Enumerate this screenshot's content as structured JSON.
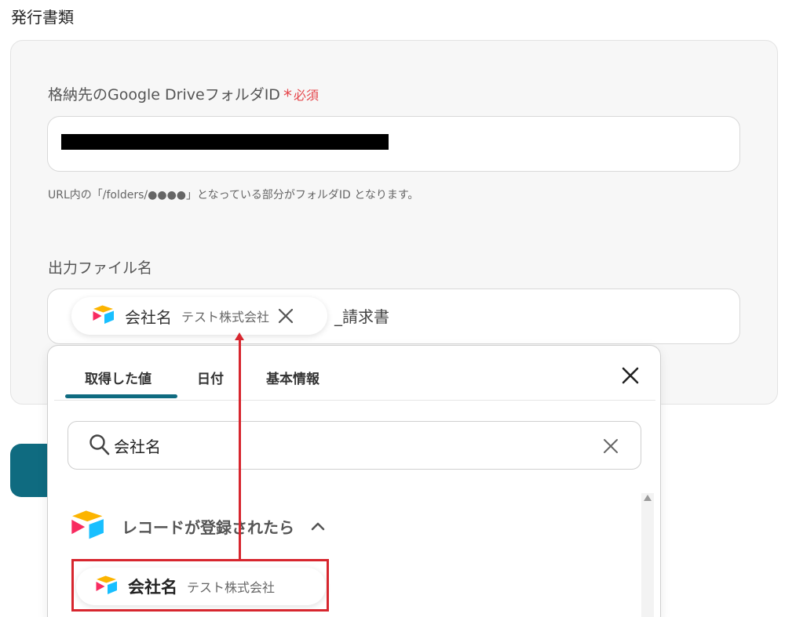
{
  "section": {
    "title": "発行書類"
  },
  "folder_field": {
    "label": "格納先のGoogle DriveフォルダID",
    "required_mark": "*",
    "required_label": "必須",
    "hint": "URL内の「/folders/●●●●」となっている部分がフォルダID となります。"
  },
  "filename_field": {
    "label": "出力ファイル名",
    "chip": {
      "name": "会社名",
      "value": "テスト株式会社"
    },
    "suffix": "_請求書"
  },
  "dropdown": {
    "tabs": [
      {
        "label": "取得した値"
      },
      {
        "label": "日付"
      },
      {
        "label": "基本情報"
      }
    ],
    "active_tab": "取得した値",
    "search": {
      "value": "会社名"
    },
    "group": {
      "title": "レコードが登録されたら"
    },
    "result": {
      "name": "会社名",
      "value": "テスト株式会社"
    }
  },
  "colors": {
    "accent": "#0f6b80",
    "required": "#e5484d",
    "highlight": "#d7262e",
    "airtable_yellow": "#fcb400",
    "airtable_blue": "#18bfff",
    "airtable_red": "#f82b60"
  },
  "icons": {
    "app_logo": "airtable-logo-icon",
    "close": "close-icon",
    "search": "search-icon",
    "chevron": "chevron-up-icon"
  }
}
